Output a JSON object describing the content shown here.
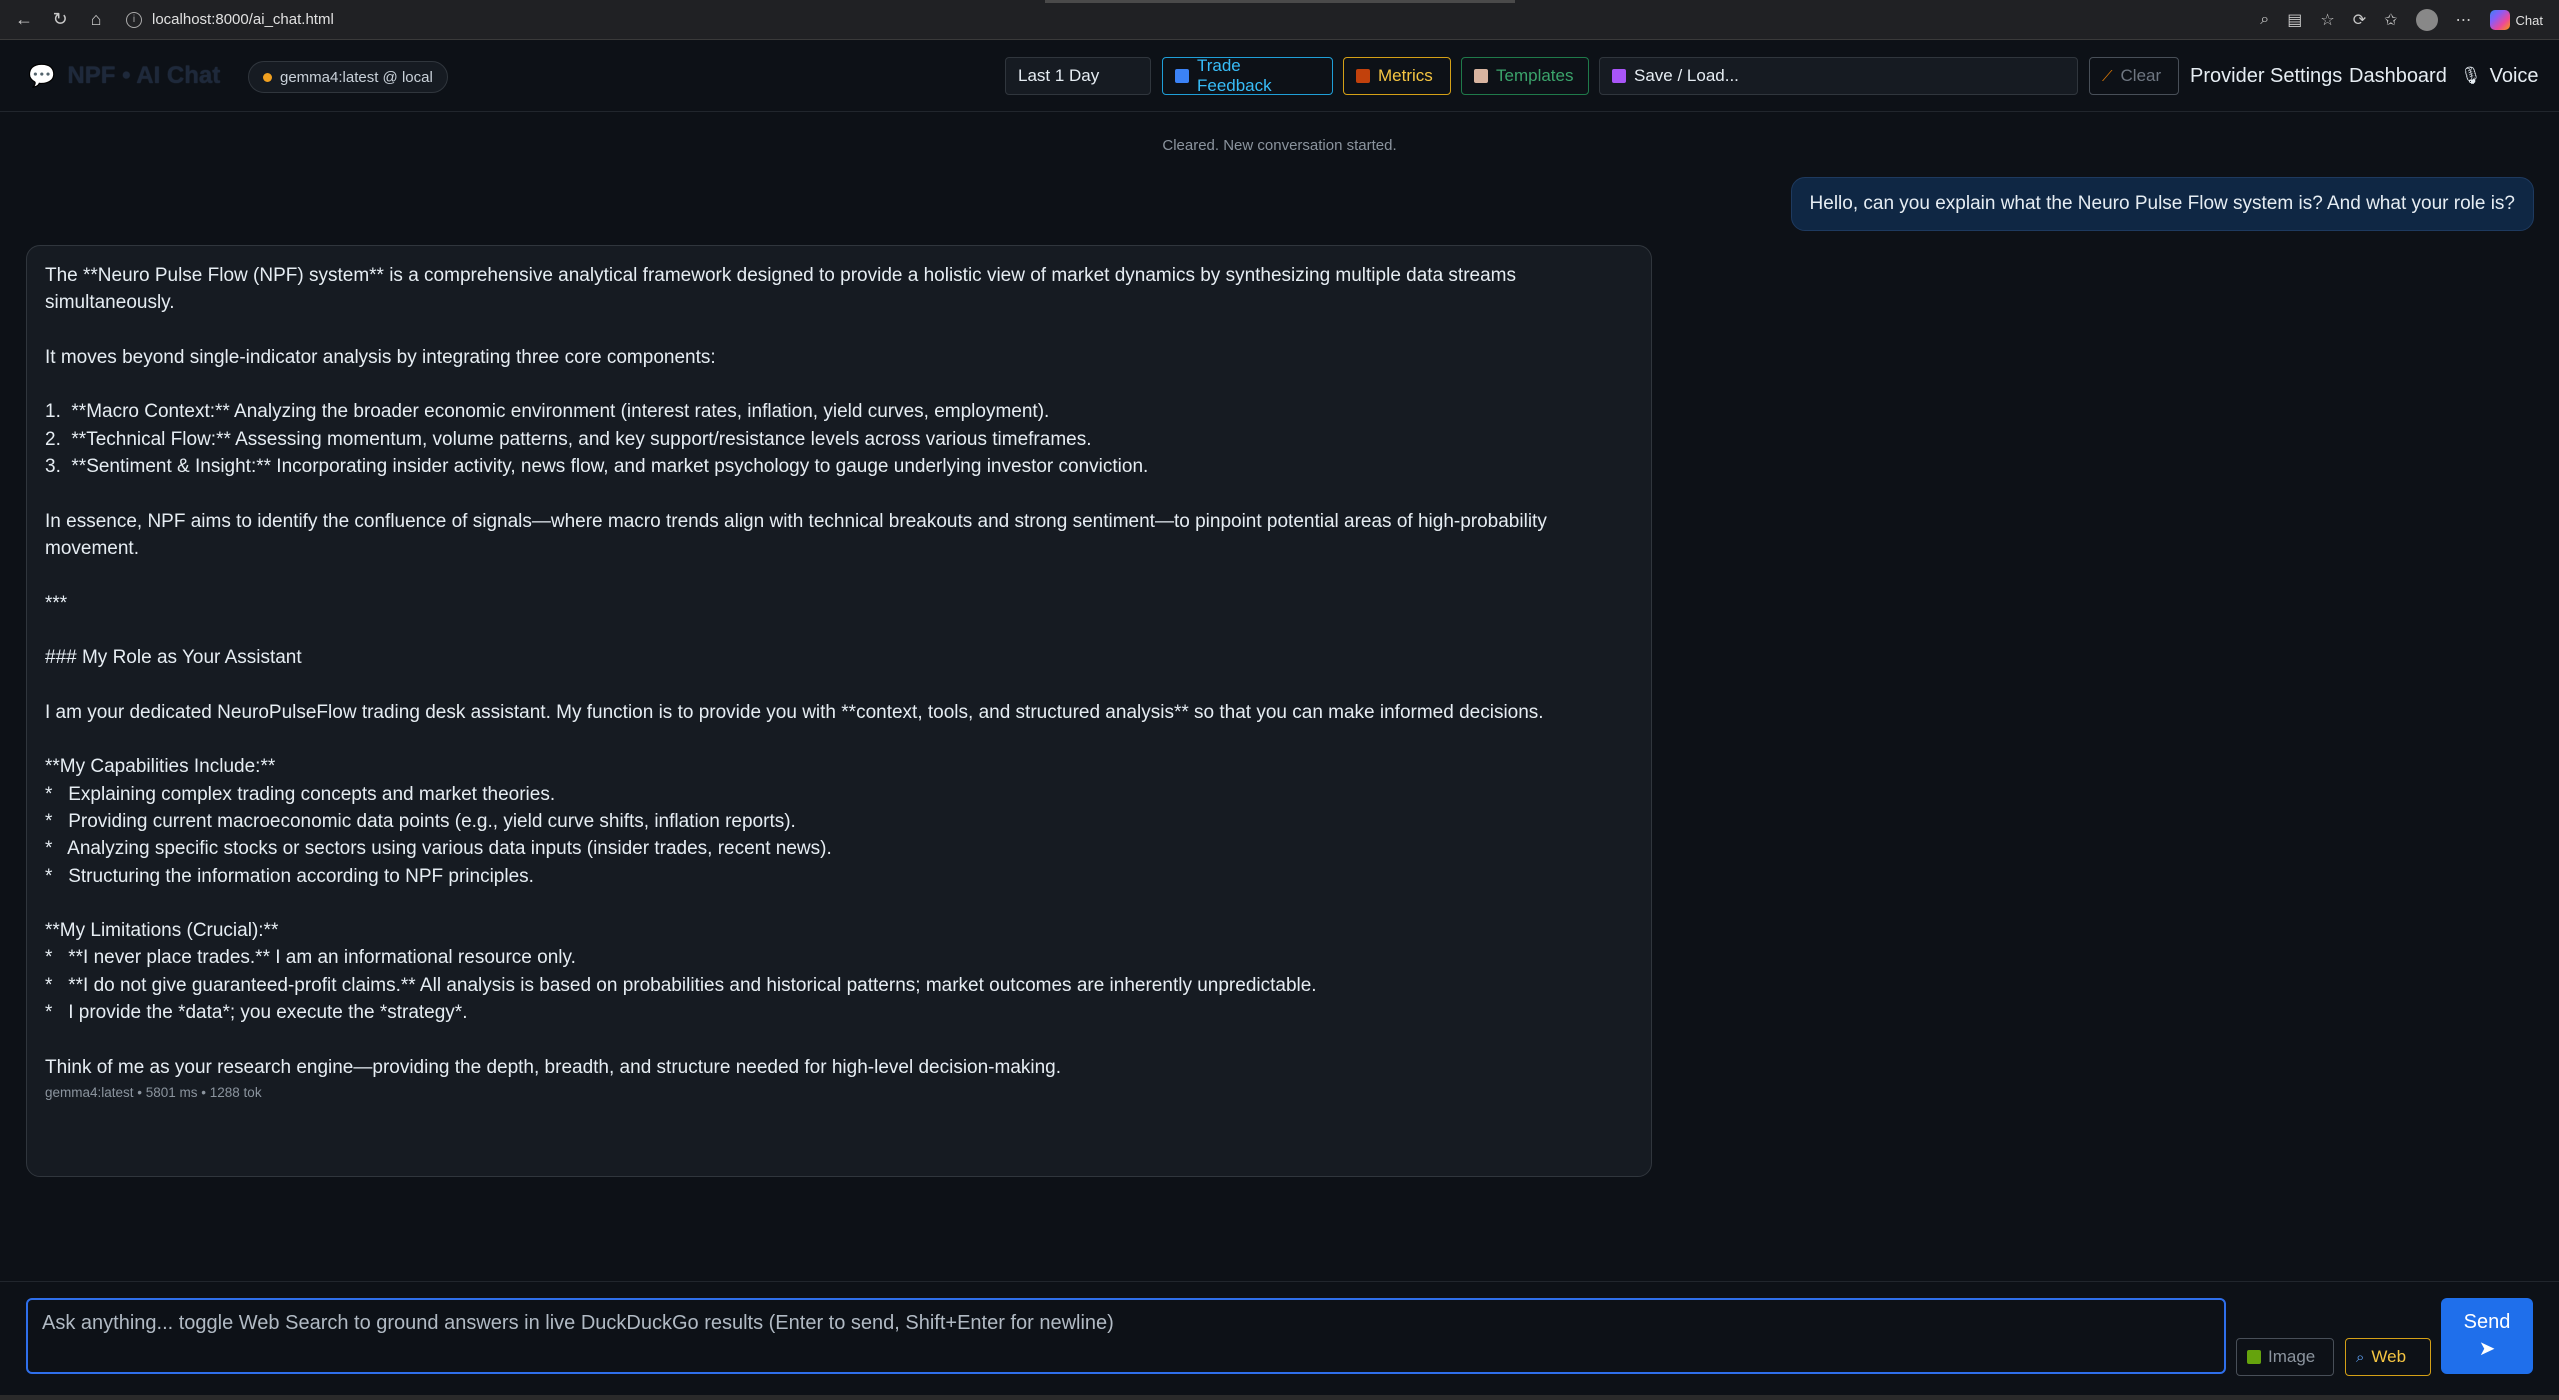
{
  "browser": {
    "url": "localhost:8000/ai_chat.html",
    "chat_label": "Chat"
  },
  "header": {
    "brand": "NPF • AI Chat",
    "model_status": "gemma4:latest @ local",
    "range": "Last 1 Day",
    "trade_feedback": "Trade Feedback",
    "metrics": "Metrics",
    "templates": "Templates",
    "save_load": "Save / Load...",
    "clear": "Clear",
    "provider_settings": "Provider Settings",
    "dashboard": "Dashboard",
    "voice": "Voice"
  },
  "chat": {
    "system_note": "Cleared. New conversation started.",
    "user_message": "Hello, can you explain what the Neuro Pulse Flow system is? And what your role is?",
    "assistant_message": "The **Neuro Pulse Flow (NPF) system** is a comprehensive analytical framework designed to provide a holistic view of market dynamics by synthesizing multiple data streams simultaneously.\n\nIt moves beyond single-indicator analysis by integrating three core components:\n\n1.  **Macro Context:** Analyzing the broader economic environment (interest rates, inflation, yield curves, employment).\n2.  **Technical Flow:** Assessing momentum, volume patterns, and key support/resistance levels across various timeframes.\n3.  **Sentiment & Insight:** Incorporating insider activity, news flow, and market psychology to gauge underlying investor conviction.\n\nIn essence, NPF aims to identify the confluence of signals—where macro trends align with technical breakouts and strong sentiment—to pinpoint potential areas of high-probability movement.\n\n***\n\n### My Role as Your Assistant\n\nI am your dedicated NeuroPulseFlow trading desk assistant. My function is to provide you with **context, tools, and structured analysis** so that you can make informed decisions.\n\n**My Capabilities Include:**\n*   Explaining complex trading concepts and market theories.\n*   Providing current macroeconomic data points (e.g., yield curve shifts, inflation reports).\n*   Analyzing specific stocks or sectors using various data inputs (insider trades, recent news).\n*   Structuring the information according to NPF principles.\n\n**My Limitations (Crucial):**\n*   **I never place trades.** I am an informational resource only.\n*   **I do not give guaranteed-profit claims.** All analysis is based on probabilities and historical patterns; market outcomes are inherently unpredictable.\n*   I provide the *data*; you execute the *strategy*.\n\nThink of me as your research engine—providing the depth, breadth, and structure needed for high-level decision-making.",
    "assistant_meta": "gemma4:latest • 5801 ms • 1288 tok"
  },
  "composer": {
    "placeholder": "Ask anything... toggle Web Search to ground answers in live DuckDuckGo results (Enter to send, Shift+Enter for newline)",
    "image": "Image",
    "web": "Web",
    "send": "Send",
    "send_arrow": "➤"
  }
}
